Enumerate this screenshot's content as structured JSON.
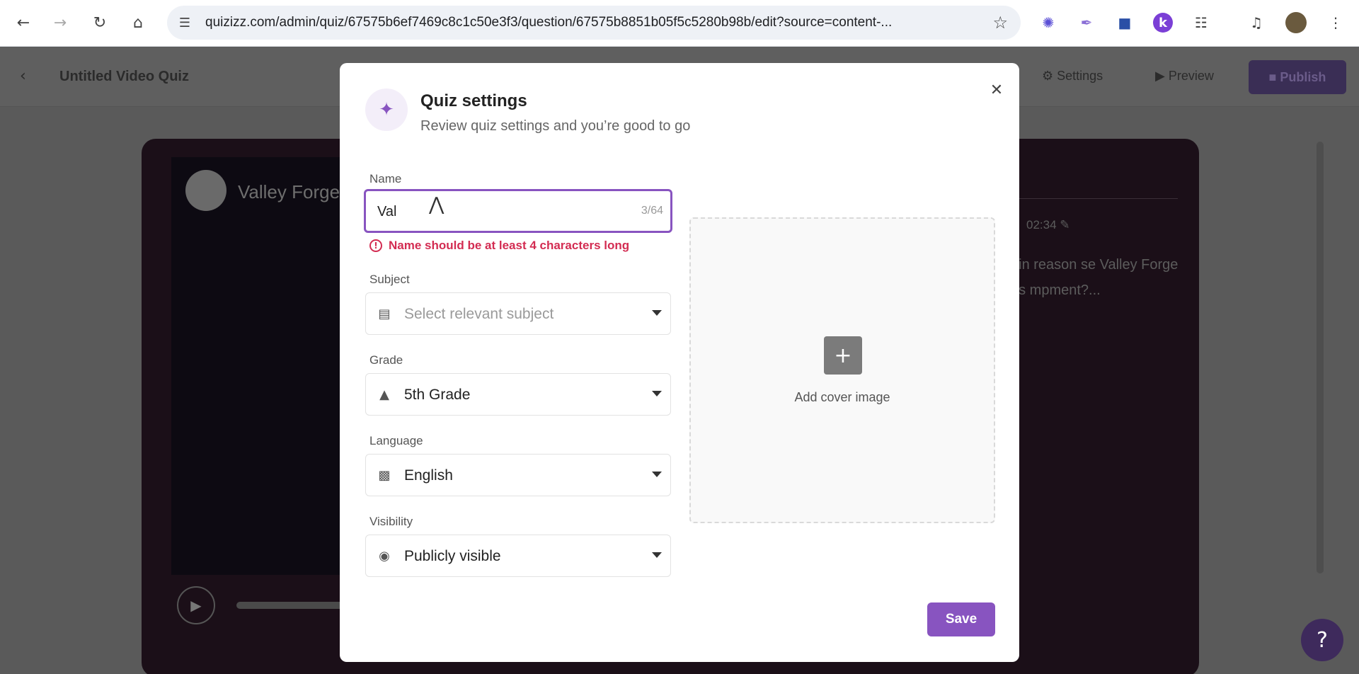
{
  "browser": {
    "url": "quizizz.com/admin/quiz/67575b6ef7469c8c1c50e3f3/question/67575b8851b05f5c5280b98b/edit?source=content-..."
  },
  "header": {
    "quiz_title": "Untitled Video Quiz",
    "settings_label": "Settings",
    "preview_label": "Preview",
    "publish_label": "Publish"
  },
  "background": {
    "channel_name": "Valley Forge",
    "timestamp": "02:34",
    "question_preview": "ain reason se Valley Forge as mpment?..."
  },
  "modal": {
    "title": "Quiz settings",
    "subtitle": "Review quiz settings and you’re good to go",
    "name": {
      "label": "Name",
      "value": "Val",
      "char_count": "3/64",
      "error": "Name should be at least 4 characters long"
    },
    "subject": {
      "label": "Subject",
      "placeholder": "Select relevant subject"
    },
    "grade": {
      "label": "Grade",
      "value": "5th Grade"
    },
    "language": {
      "label": "Language",
      "value": "English"
    },
    "visibility": {
      "label": "Visibility",
      "value": "Publicly visible"
    },
    "cover": {
      "label": "Add cover image"
    },
    "save_label": "Save"
  },
  "colors": {
    "accent": "#8854c0",
    "error": "#d32c52"
  }
}
